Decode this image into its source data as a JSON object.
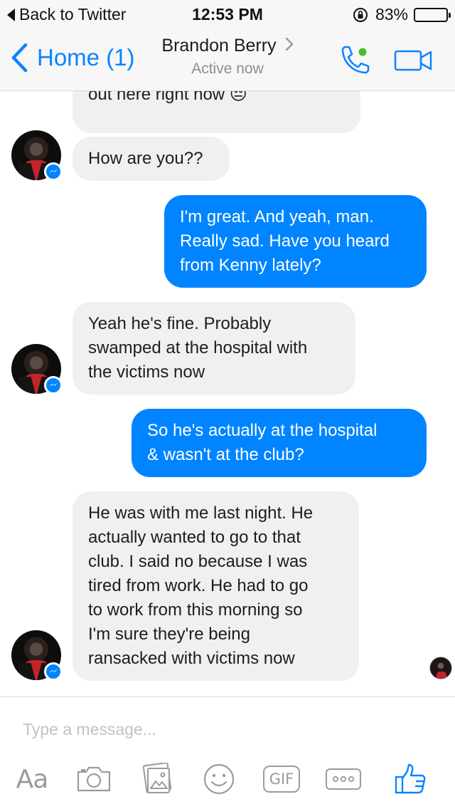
{
  "status_bar": {
    "back_label": "Back to Twitter",
    "time": "12:53 PM",
    "battery_text": "83%",
    "battery_level": 0.83
  },
  "nav": {
    "back_label": "Home (1)",
    "contact_name": "Brandon Berry",
    "presence": "Active now",
    "accent_color": "#0a84ff",
    "call_icon": "phone-icon",
    "video_icon": "video-camera-icon"
  },
  "messages": [
    {
      "from": "contact",
      "lines": [
        "out here right now 😔"
      ]
    },
    {
      "from": "contact",
      "lines": [
        "How are you??"
      ]
    },
    {
      "from": "me",
      "lines": [
        "I'm great. And yeah, man.",
        "Really sad. Have you heard",
        "from Kenny lately?"
      ]
    },
    {
      "from": "contact",
      "lines": [
        "Yeah he's fine. Probably",
        "swamped at the hospital with",
        "the victims now"
      ]
    },
    {
      "from": "me",
      "lines": [
        "So he's actually at the hospital",
        "& wasn't at the club?"
      ]
    },
    {
      "from": "contact",
      "lines": [
        "He was with me last night. He",
        "actually wanted to go to that",
        "club. I said no because I was",
        "tired from work. He had to go",
        "to work from this morning so",
        "I'm sure they're being",
        "ransacked with victims now"
      ]
    }
  ],
  "colors": {
    "outgoing_bubble": "#0084ff",
    "incoming_bubble": "#f1f0f0",
    "toolbar_icon": "#9a9aa0",
    "like_icon": "#0a84ff"
  },
  "composer": {
    "placeholder": "Type a message...",
    "value": "",
    "text_format_label": "Aa",
    "gif_label": "GIF",
    "tools": [
      "text-format-icon",
      "camera-icon",
      "photo-gallery-icon",
      "emoji-icon",
      "gif-icon",
      "more-icon",
      "like-thumbs-up-icon"
    ]
  }
}
